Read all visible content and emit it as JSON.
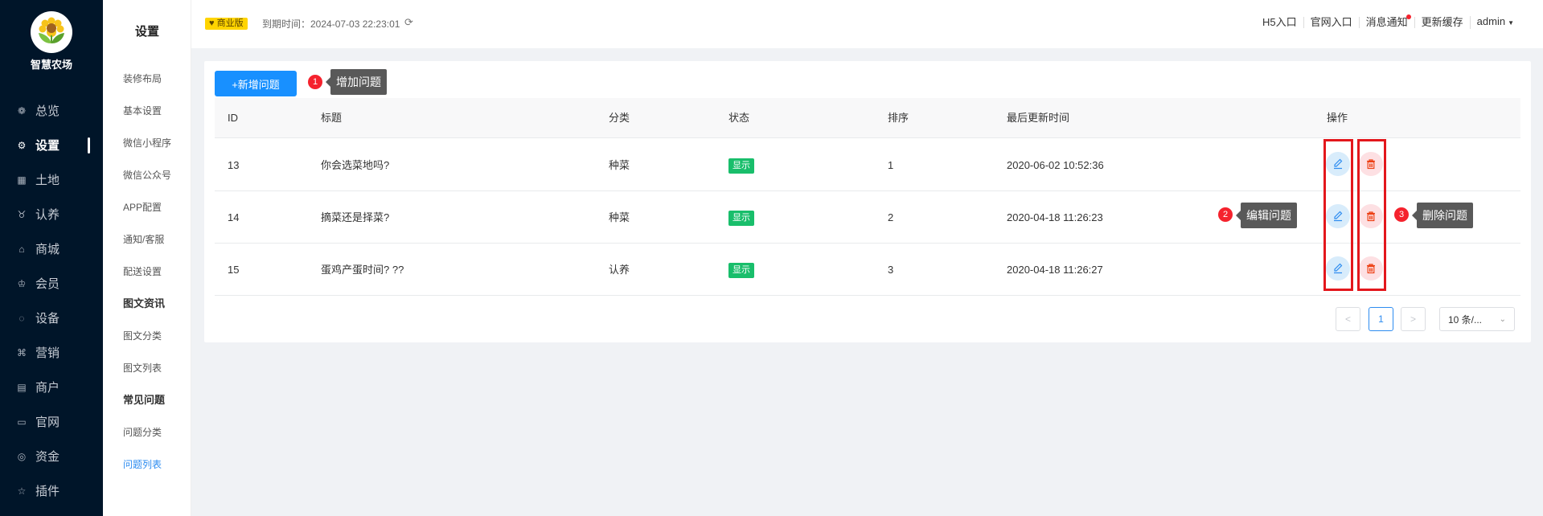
{
  "brand": {
    "name": "智慧农场"
  },
  "nav": [
    {
      "label": "总览",
      "icon": "dashboard-icon",
      "glyph": "❁"
    },
    {
      "label": "设置",
      "icon": "settings-icon",
      "glyph": "⚙",
      "active": true
    },
    {
      "label": "土地",
      "icon": "land-icon",
      "glyph": "▦"
    },
    {
      "label": "认养",
      "icon": "adopt-icon",
      "glyph": "♉"
    },
    {
      "label": "商城",
      "icon": "mall-icon",
      "glyph": "⌂"
    },
    {
      "label": "会员",
      "icon": "member-icon",
      "glyph": "♔"
    },
    {
      "label": "设备",
      "icon": "device-icon",
      "glyph": "◌"
    },
    {
      "label": "营销",
      "icon": "marketing-icon",
      "glyph": "⌘"
    },
    {
      "label": "商户",
      "icon": "merchant-icon",
      "glyph": "▤"
    },
    {
      "label": "官网",
      "icon": "website-icon",
      "glyph": "▭"
    },
    {
      "label": "资金",
      "icon": "funds-icon",
      "glyph": "◎"
    },
    {
      "label": "插件",
      "icon": "plugin-icon",
      "glyph": "☆"
    }
  ],
  "submenu": {
    "title": "设置",
    "items": [
      {
        "label": "装修布局"
      },
      {
        "label": "基本设置"
      },
      {
        "label": "微信小程序"
      },
      {
        "label": "微信公众号"
      },
      {
        "label": "APP配置"
      },
      {
        "label": "通知/客服"
      },
      {
        "label": "配送设置"
      },
      {
        "label": "图文资讯",
        "group": true
      },
      {
        "label": "图文分类"
      },
      {
        "label": "图文列表"
      },
      {
        "label": "常见问题",
        "group": true
      },
      {
        "label": "问题分类"
      },
      {
        "label": "问题列表",
        "active": true
      }
    ]
  },
  "header": {
    "badge": "商业版",
    "expire": "到期时间：2024-07-03 22:23:01",
    "links": [
      "H5入口",
      "官网入口",
      "消息通知",
      "更新缓存"
    ],
    "user": "admin"
  },
  "toolbar": {
    "add_label": "+新增问题"
  },
  "table": {
    "columns": [
      "ID",
      "标题",
      "分类",
      "状态",
      "排序",
      "最后更新时间",
      "操作"
    ],
    "rows": [
      {
        "id": "13",
        "title": "你会选菜地吗?",
        "category": "种菜",
        "status": "显示",
        "sort": "1",
        "updated": "2020-06-02 10:52:36"
      },
      {
        "id": "14",
        "title": "摘菜还是择菜?",
        "category": "种菜",
        "status": "显示",
        "sort": "2",
        "updated": "2020-04-18 11:26:23"
      },
      {
        "id": "15",
        "title": "蛋鸡产蛋时间?  ??",
        "category": "认养",
        "status": "显示",
        "sort": "3",
        "updated": "2020-04-18 11:26:27"
      }
    ]
  },
  "pagination": {
    "prev": "<",
    "current": "1",
    "next": ">",
    "page_size": "10 条/..."
  },
  "annotations": [
    {
      "num": "1",
      "label": "增加问题"
    },
    {
      "num": "2",
      "label": "编辑问题"
    },
    {
      "num": "3",
      "label": "删除问题"
    }
  ],
  "colors": {
    "primary": "#1890ff",
    "nav_bg": "#001529",
    "status_green": "#19be6b",
    "highlight_red": "#e3171c",
    "badge_yellow": "#ffd400"
  }
}
